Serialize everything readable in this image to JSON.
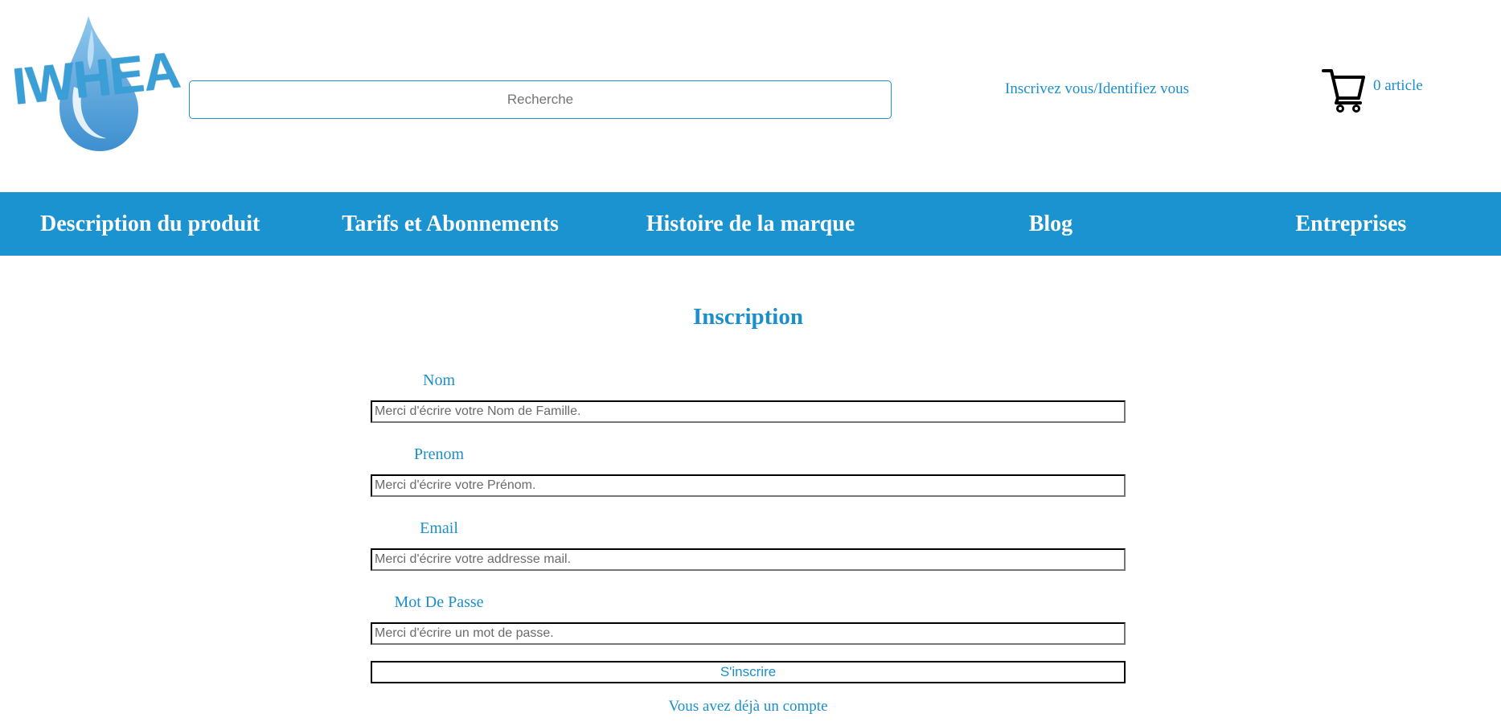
{
  "header": {
    "logo_text": "IWHEA",
    "search_placeholder": "Recherche",
    "auth_link": "Inscrivez vous/Identifiez vous",
    "cart_count": "0 article"
  },
  "nav": {
    "items": [
      {
        "label": "Description du produit"
      },
      {
        "label": "Tarifs et Abonnements"
      },
      {
        "label": "Histoire de la marque"
      },
      {
        "label": "Blog"
      },
      {
        "label": "Entreprises"
      }
    ]
  },
  "main": {
    "title": "Inscription",
    "fields": [
      {
        "label": "Nom",
        "placeholder": "Merci d'écrire votre Nom de Famille."
      },
      {
        "label": "Prenom",
        "placeholder": "Merci d'écrire votre Prénom."
      },
      {
        "label": "Email",
        "placeholder": "Merci d'écrire votre addresse mail."
      },
      {
        "label": "Mot De Passe",
        "placeholder": "Merci d'écrire un mot de passe."
      }
    ],
    "submit_label": "S'inscrire",
    "login_link": "Vous avez déjà un compte"
  },
  "colors": {
    "brand_blue": "#1b93d0",
    "text_blue": "#1b8fcc",
    "nav_text": "#ffffff"
  },
  "icons": {
    "logo": "water-drop-icon",
    "cart": "shopping-cart-icon"
  }
}
